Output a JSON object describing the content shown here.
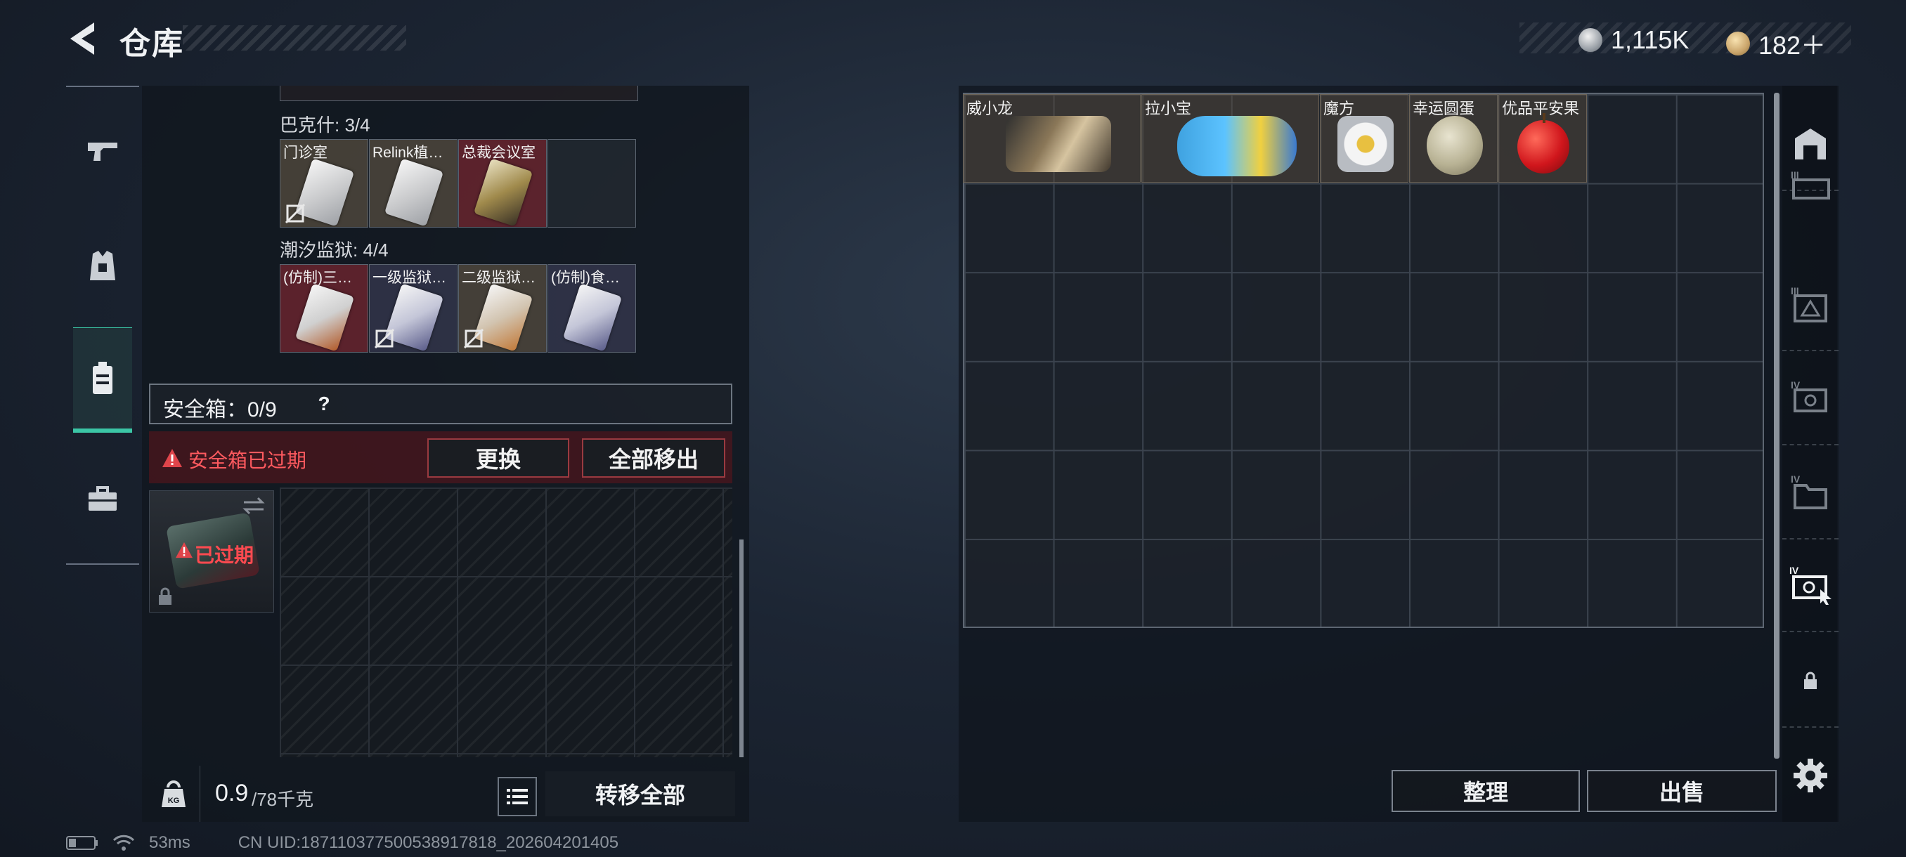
{
  "header": {
    "title": "仓库",
    "currency_silver": "1,115K",
    "currency_gold": "182＋"
  },
  "left_panel": {
    "group_top": {
      "label": "巴克什: 3/4",
      "items": [
        {
          "name": "门诊室",
          "locked": true
        },
        {
          "name": "Relink植…",
          "locked": false
        },
        {
          "name": "总裁会议室",
          "locked": false
        }
      ]
    },
    "group_bottom": {
      "label": "潮汐监狱: 4/4",
      "items": [
        {
          "name": "(仿制)三…",
          "locked": false
        },
        {
          "name": "一级监狱…",
          "locked": true
        },
        {
          "name": "二级监狱…",
          "locked": true
        },
        {
          "name": "(仿制)食…",
          "locked": false
        }
      ]
    },
    "safebox": {
      "label": "安全箱：0/9",
      "help": "?",
      "alert": "安全箱已过期",
      "replace": "更换",
      "remove_all": "全部移出",
      "expired": "已过期"
    },
    "weight": {
      "current": "0.9",
      "max": "/78千克",
      "kg_icon_text": "KG"
    },
    "transfer_all": "转移全部"
  },
  "warehouse": {
    "items": [
      {
        "name": "威小龙"
      },
      {
        "name": "拉小宝"
      },
      {
        "name": "魔方"
      },
      {
        "name": "幸运圆蛋"
      },
      {
        "name": "优品平安果"
      }
    ],
    "sort": "整理",
    "sell": "出售"
  },
  "footer": {
    "ping": "53ms",
    "uid": "CN UID:18711037750053891781​8_202604201405"
  },
  "colors": {
    "accent_teal": "#3bc6a6",
    "alert_red": "#e0454b",
    "panel_bg": "#11171f"
  }
}
